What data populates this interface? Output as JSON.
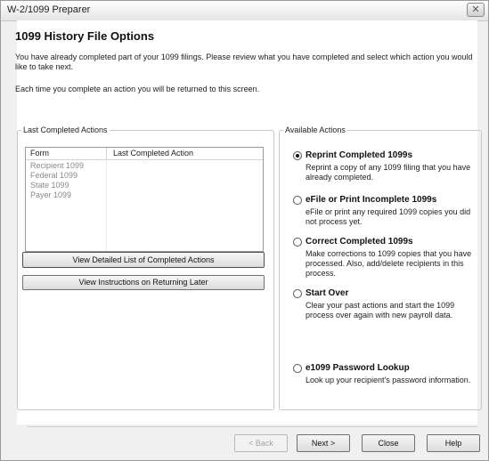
{
  "window": {
    "title": "W-2/1099 Preparer",
    "close_glyph": "✕"
  },
  "heading": "1099 History File Options",
  "intro": {
    "line1": "You have already completed part of your 1099 filings. Please review what you have completed and select which action you would like to take next.",
    "line2": "Each time you complete an action you will be returned to this screen."
  },
  "last_completed": {
    "legend": "Last Completed Actions",
    "columns": [
      "Form",
      "Last Completed Action"
    ],
    "rows": [
      "Recipient 1099",
      "Federal 1099",
      "State 1099",
      "Payer 1099"
    ],
    "view_detailed_label": "View Detailed List of Completed Actions",
    "view_instructions_label": "View Instructions on Returning Later"
  },
  "available_actions": {
    "legend": "Available Actions",
    "selected": "reprint",
    "options": [
      {
        "id": "reprint",
        "label": "Reprint Completed 1099s",
        "desc": "Reprint a copy of any 1099 filing that you have already completed."
      },
      {
        "id": "efile",
        "label": "eFile or Print Incomplete 1099s",
        "desc": "eFile or print any required 1099 copies you did not process yet."
      },
      {
        "id": "correct",
        "label": "Correct Completed 1099s",
        "desc": "Make corrections to 1099 copies that you have processed. Also, add/delete recipients in this process."
      },
      {
        "id": "startover",
        "label": "Start Over",
        "desc": "Clear your past actions and start the 1099 process over again with new payroll data."
      },
      {
        "id": "password",
        "label": "e1099 Password Lookup",
        "desc": "Look up your recipient's password information."
      }
    ]
  },
  "footer": {
    "back": "< Back",
    "next": "Next >",
    "close": "Close",
    "help": "Help"
  }
}
